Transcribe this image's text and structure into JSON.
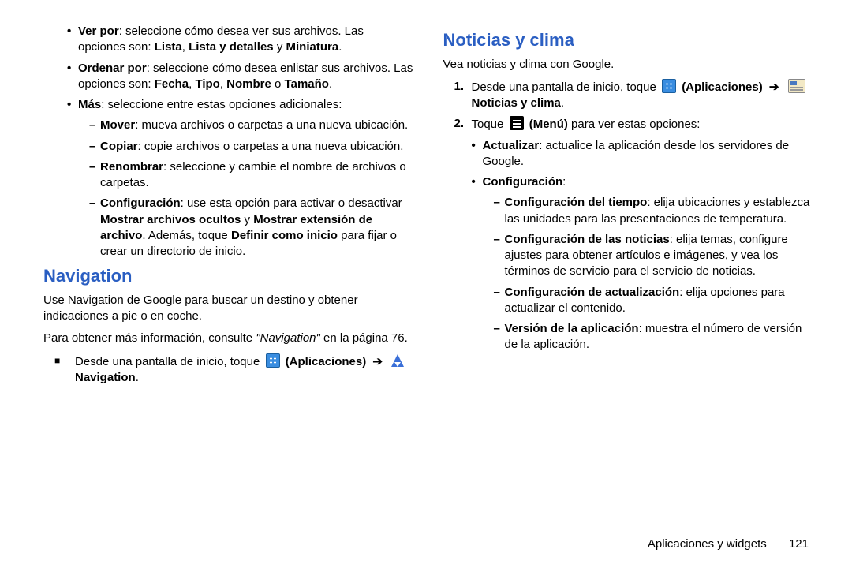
{
  "left": {
    "b1": {
      "label": "Ver por",
      "rest": ": seleccione cómo desea ver sus archivos. Las opciones son: ",
      "opts": "Lista",
      "sep1": ", ",
      "opts2": "Lista y detalles",
      "sep2": " y ",
      "opts3": "Miniatura",
      "end": "."
    },
    "b2": {
      "label": "Ordenar por",
      "rest": ": seleccione cómo desea enlistar sus archivos. Las opciones son: ",
      "o1": "Fecha",
      "s1": ", ",
      "o2": "Tipo",
      "s2": ", ",
      "o3": "Nombre",
      "s3": " o ",
      "o4": "Tamaño",
      "end": "."
    },
    "b3": {
      "label": "Más",
      "rest": ": seleccione entre estas opciones adicionales:"
    },
    "d1": {
      "label": "Mover",
      "rest": ": mueva archivos o carpetas a una nueva ubicación."
    },
    "d2": {
      "label": "Copiar",
      "rest": ": copie archivos o carpetas a una nueva ubicación."
    },
    "d3": {
      "label": "Renombrar",
      "rest": ": seleccione y cambie el nombre de archivos o carpetas."
    },
    "d4": {
      "label": "Configuración",
      "rest": ": use esta opción para activar o desactivar ",
      "b1": "Mostrar archivos ocultos",
      "m1": " y ",
      "b2": "Mostrar extensión de archivo",
      "m2": ". Además, toque ",
      "b3": "Definir como inicio",
      "m3": " para fijar o crear un directorio de inicio."
    },
    "nav_h": "Navigation",
    "nav_p1": "Use Navigation de Google para buscar un destino y obtener indicaciones a pie o en coche.",
    "nav_p2a": "Para obtener más información, consulte ",
    "nav_p2b": "\"Navigation\"",
    "nav_p2c": " en la página 76.",
    "nav_step_a": "Desde una pantalla de inicio, toque ",
    "apps_label": "(Aplicaciones)",
    "arrow": "➔",
    "nav_label": "Navigation",
    "dot": "."
  },
  "right": {
    "h": "Noticias y clima",
    "intro": "Vea noticias y clima con Google.",
    "n1a": "Desde una pantalla de inicio, toque ",
    "apps_label": "(Aplicaciones)",
    "arrow": "➔",
    "nc_label": "Noticias y clima",
    "dot": ".",
    "n2a": "Toque ",
    "menu_label": "(Menú)",
    "n2b": " para ver estas opciones:",
    "s1": {
      "label": "Actualizar",
      "rest": ": actualice la aplicación desde los servidores de Google."
    },
    "s2": {
      "label": "Configuración",
      "rest": ":"
    },
    "c1": {
      "label": "Configuración del tiempo",
      "rest": ": elija ubicaciones y establezca las unidades para las presentaciones de temperatura."
    },
    "c2": {
      "label": "Configuración de las noticias",
      "rest": ": elija temas, configure ajustes para obtener artículos e imágenes, y vea los términos de servicio para el servicio de noticias."
    },
    "c3": {
      "label": "Configuración de actualización",
      "rest": ": elija opciones para actualizar el contenido."
    },
    "c4": {
      "label": "Versión de la aplicación",
      "rest": ": muestra el número de versión de la aplicación."
    }
  },
  "footer": {
    "section": "Aplicaciones y widgets",
    "page": "121"
  }
}
